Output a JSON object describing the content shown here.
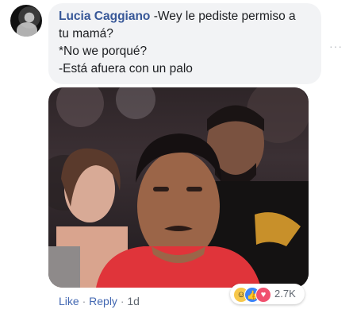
{
  "comment": {
    "author": "Lucia Caggiano",
    "text_lines": [
      " -Wey le pediste permiso a",
      "tu mamá?",
      "*No we porqué?",
      "-Está afuera con un palo"
    ]
  },
  "reactions": {
    "count": "2.7K",
    "icons": [
      "haha-icon",
      "like-icon",
      "love-icon"
    ]
  },
  "actions": {
    "like": "Like",
    "reply": "Reply",
    "separator": "·",
    "time": "1d"
  },
  "more_glyph": "···",
  "colors": {
    "author": "#385898",
    "link": "#4267b2",
    "bubble": "#f2f3f5"
  }
}
